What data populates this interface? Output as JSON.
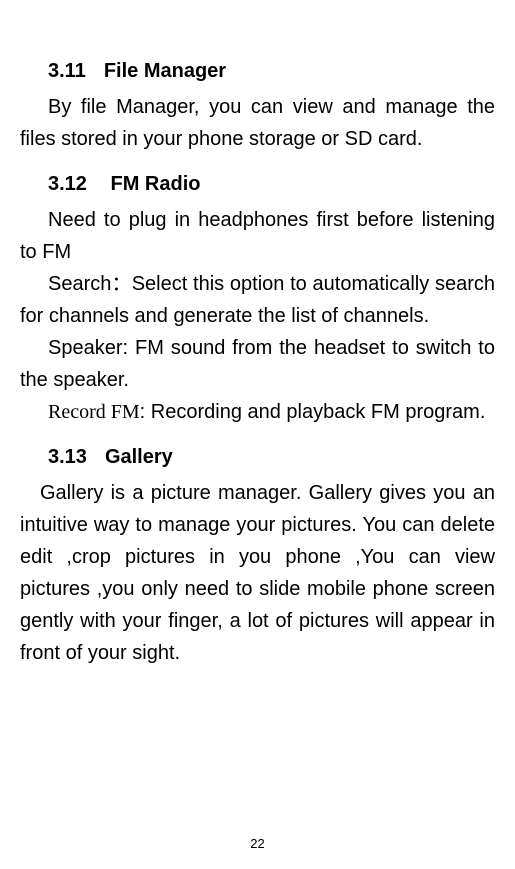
{
  "sections": {
    "s311": {
      "num": "3.11",
      "title": "File Manager",
      "body": "By file Manager, you can view and manage the files stored in your phone storage or SD card."
    },
    "s312": {
      "num": "3.12",
      "title": "FM Radio",
      "intro": "Need to plug in headphones first before listening to FM",
      "search": "Search：Select this option to automatically search for channels and generate the list of channels.",
      "speaker": "Speaker: FM sound from the headset to switch to the speaker.",
      "record_label": "Record FM",
      "record_rest": ": Recording and playback FM program."
    },
    "s313": {
      "num": "3.13",
      "title": "Gallery",
      "body": "Gallery is a picture manager. Gallery gives you an intuitive way to manage your pictures. You can delete edit ,crop pictures in you phone ,You can view pictures ,you only need to  slide mobile phone screen gently with your  finger, a lot of pictures will appear in front of your sight."
    }
  },
  "page_number": "22"
}
